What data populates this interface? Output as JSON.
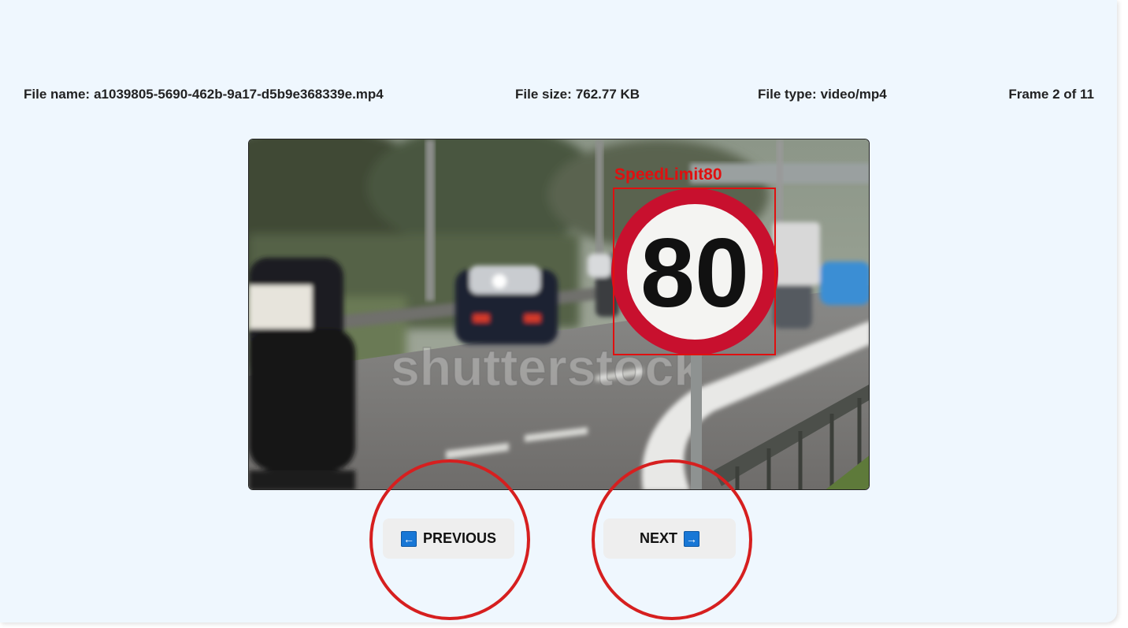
{
  "file_info": {
    "name_label": "File name:",
    "name_value": "a1039805-5690-462b-9a17-d5b9e368339e.mp4",
    "size_label": "File size:",
    "size_value": "762.77 KB",
    "type_label": "File type:",
    "type_value": "video/mp4",
    "frame_text": "Frame 2 of 11"
  },
  "frame_view": {
    "detection_label": "SpeedLimit80",
    "sign_number": "80",
    "watermark": "shutterstock",
    "detection_color": "#e01010"
  },
  "nav": {
    "previous_label": "PREVIOUS",
    "previous_icon": "left-arrow-icon",
    "next_label": "NEXT",
    "next_icon": "right-arrow-icon"
  },
  "colors": {
    "panel_bg": "#eff7fe",
    "button_bg": "#eeeeee",
    "arrow_icon_bg": "#1877d6",
    "annotation_circle": "#d61f1f"
  }
}
